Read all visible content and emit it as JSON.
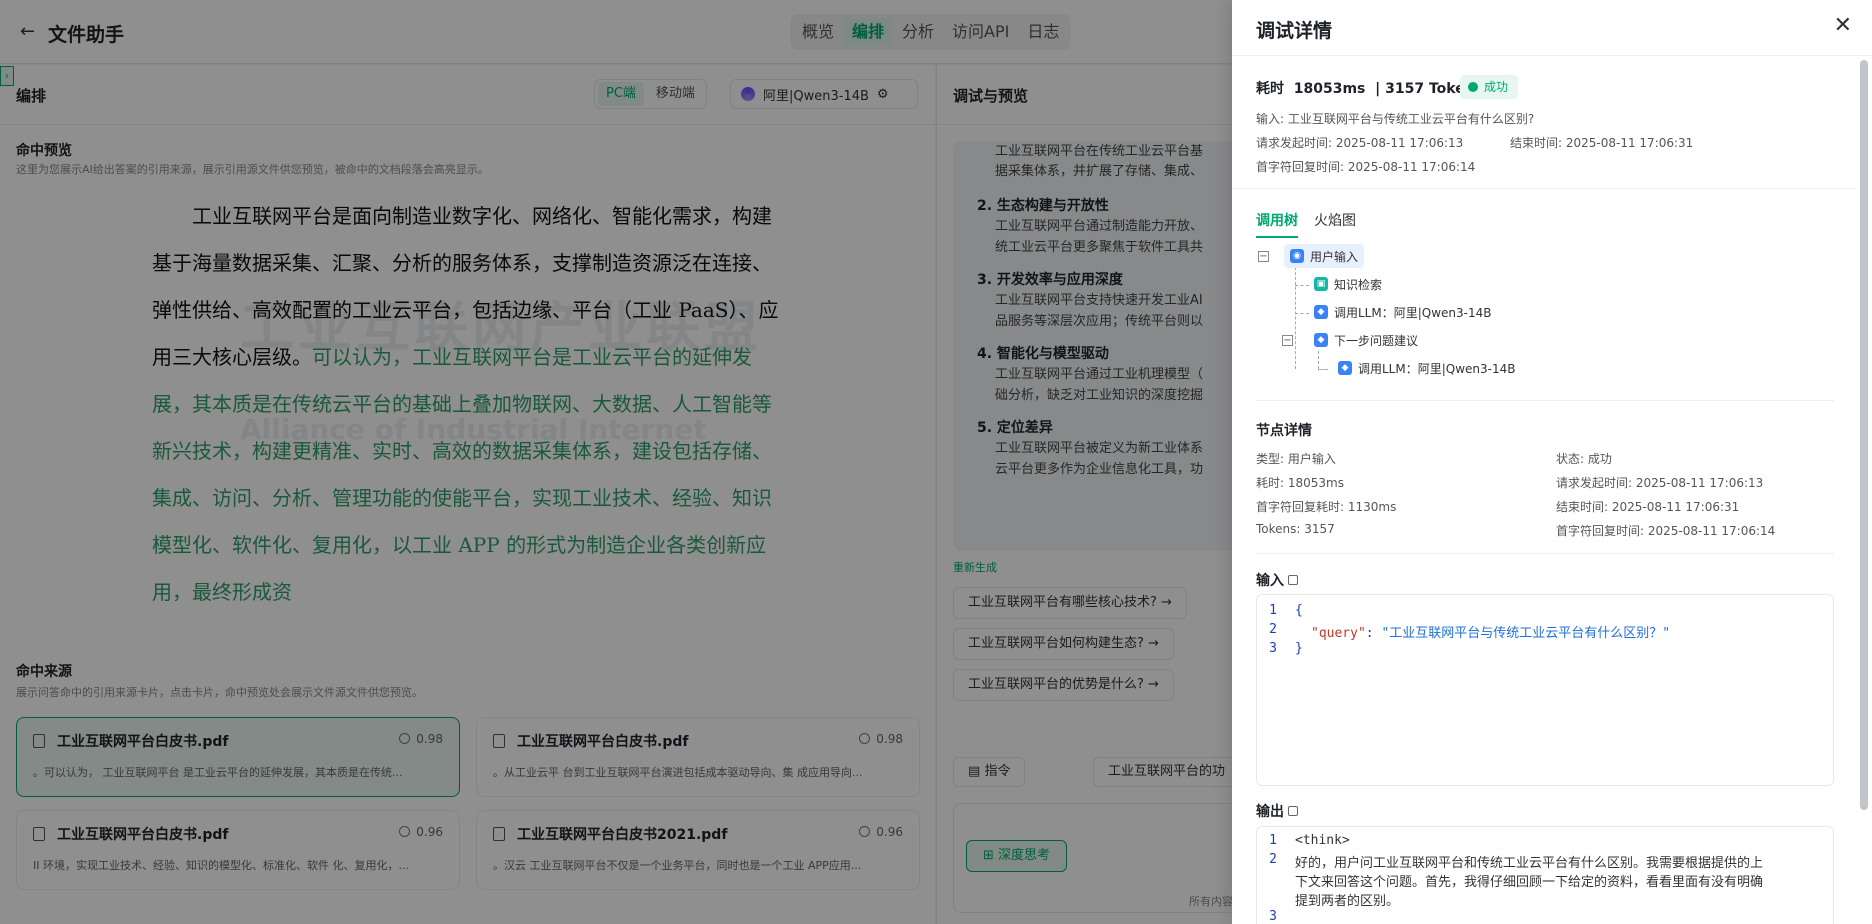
{
  "app": {
    "title": "文件助手",
    "back_icon": "arrow-left-icon"
  },
  "nav": {
    "tabs": [
      "概览",
      "编排",
      "分析",
      "访问API",
      "日志"
    ],
    "active": 1
  },
  "editor": {
    "label": "编排",
    "device_tabs": [
      "PC端",
      "移动端"
    ],
    "model": "阿里|Qwen3-14B"
  },
  "preview": {
    "title": "命中预览",
    "desc": "这里为您展示AI给出答案的引用来源，展示引用源文件供您预览，被命中的文档段落会高亮显示。",
    "watermark_1": "工业互联网产业联盟",
    "watermark_2": "Alliance of Industrial Internet",
    "text_normal": "工业互联网平台是面向制造业数字化、网络化、智能化需求，构建基于海量数据采集、汇聚、分析的服务体系，支撑制造资源泛在连接、弹性供给、高效配置的工业云平台，包括边缘、平台（工业 PaaS）、应用三大核心层级。",
    "text_highlight": "可以认为，工业互联网平台是工业云平台的延伸发展，其本质是在传统云平台的基础上叠加物联网、大数据、人工智能等新兴技术，构建更精准、实时、高效的数据采集体系，建设包括存储、集成、访问、分析、管理功能的使能平台，实现工业技术、经验、知识模型化、软件化、复用化，以工业 APP 的形式为制造企业各类创新应用，最终形成资"
  },
  "sources": {
    "title": "命中来源",
    "desc": "展示问答命中的引用来源卡片，点击卡片，命中预览处会展示文件源文件供您预览。",
    "cards": [
      {
        "name": "工业互联网平台白皮书.pdf",
        "score": "0.98",
        "snippet": "。可以认为， 工业互联网平台 是工业云平台的延伸发展，其本质是在传统..."
      },
      {
        "name": "工业互联网平台白皮书.pdf",
        "score": "0.98",
        "snippet": "。从工业云平 台到工业互联网平台演进包括成本驱动导向、集 成应用导向..."
      },
      {
        "name": "工业互联网平台白皮书.pdf",
        "score": "0.96",
        "snippet": "II 环境，实现工业技术、经验、知识的模型化、标准化、软件 化、复用化，..."
      },
      {
        "name": "工业互联网平台白皮书2021.pdf",
        "score": "0.96",
        "snippet": "。汉云 工业互联网平台不仅是一个业务平台，同时也是一个工业 APP应用..."
      }
    ]
  },
  "debug": {
    "label": "调试与预览",
    "top_partial_1": "工业互联网平台在传统工业云平台基",
    "top_partial_2": "据采集体系，并扩展了存储、集成、",
    "items": [
      {
        "title": "2. 生态构建与开放性",
        "lines": [
          "工业互联网平台通过制造能力开放、",
          "统工业云平台更多聚焦于软件工具共"
        ]
      },
      {
        "title": "3. 开发效率与应用深度",
        "lines": [
          "工业互联网平台支持快速开发工业AI",
          "品服务等深层次应用；传统平台则以"
        ]
      },
      {
        "title": "4. 智能化与模型驱动",
        "lines": [
          "工业互联网平台通过工业机理模型（",
          "础分析，缺乏对工业知识的深度挖掘"
        ]
      },
      {
        "title": "5. 定位差异",
        "lines": [
          "工业互联网平台被定义为新工业体系",
          "云平台更多作为企业信息化工具，功"
        ]
      }
    ],
    "regen": "重新生成",
    "suggestions": [
      "工业互联网平台有哪些核心技术?",
      "工业互联网平台如何构建生态?",
      "工业互联网平台的优势是什么?"
    ],
    "command": "指令",
    "command_2": "工业互联网平台的功",
    "deep_think": "深度思考",
    "footer": "所有内容"
  },
  "drawer": {
    "title": "调试详情",
    "elapsed_label": "耗时",
    "elapsed": "18053ms",
    "tokens": "3157 Tokens",
    "status": "成功",
    "input_line": "输入: 工业互联网平台与传统工业云平台有什么区别?",
    "req_time": "请求发起时间: 2025-08-11 17:06:13",
    "end_time": "结束时间: 2025-08-11 17:06:31",
    "first_time": "首字符回复时间: 2025-08-11 17:06:14",
    "tabs": [
      "调用树",
      "火焰图"
    ],
    "tree": [
      "用户输入",
      "知识检索",
      "调用LLM：阿里|Qwen3-14B",
      "下一步问题建议",
      "调用LLM：阿里|Qwen3-14B"
    ],
    "node_title": "节点详情",
    "node_left": [
      "类型: 用户输入",
      "耗时: 18053ms",
      "首字符回复耗时: 1130ms",
      "Tokens: 3157"
    ],
    "node_right": [
      "状态: 成功",
      "请求发起时间: 2025-08-11 17:06:13",
      "结束时间: 2025-08-11 17:06:31",
      "首字符回复时间: 2025-08-11 17:06:14"
    ],
    "input_title": "输入",
    "input_key": "\"query\"",
    "input_value": "\"工业互联网平台与传统工业云平台有什么区别？\"",
    "output_title": "输出",
    "output_l1": "<think>",
    "output_l2": [
      "好的，用户问工业互联网平台和传统工业云平台有什么区别。我需要根据提供的上",
      "下文来回答这个问题。首先，我得仔细回顾一下给定的资料，看看里面有没有明确",
      "提到两者的区别。"
    ],
    "close_icon": "close-icon"
  }
}
